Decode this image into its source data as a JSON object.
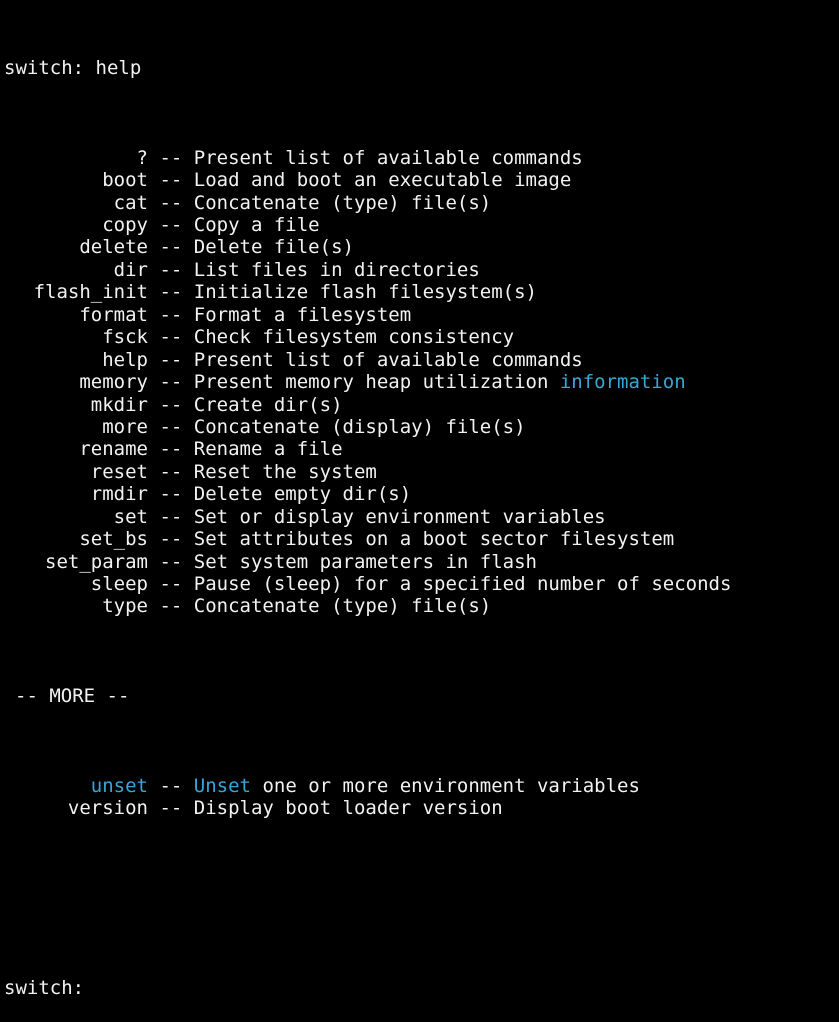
{
  "terminal": {
    "command_line": "switch: help",
    "separator": "--",
    "commands": [
      {
        "name": "?",
        "description": "Present list of available commands"
      },
      {
        "name": "boot",
        "description": "Load and boot an executable image"
      },
      {
        "name": "cat",
        "description": "Concatenate (type) file(s)"
      },
      {
        "name": "copy",
        "description": "Copy a file"
      },
      {
        "name": "delete",
        "description": "Delete file(s)"
      },
      {
        "name": "dir",
        "description": "List files in directories"
      },
      {
        "name": "flash_init",
        "description": "Initialize flash filesystem(s)"
      },
      {
        "name": "format",
        "description": "Format a filesystem"
      },
      {
        "name": "fsck",
        "description": "Check filesystem consistency"
      },
      {
        "name": "help",
        "description": "Present list of available commands"
      },
      {
        "name": "memory",
        "description": "Present memory heap utilization ",
        "highlight_word": "information"
      },
      {
        "name": "mkdir",
        "description": "Create dir(s)"
      },
      {
        "name": "more",
        "description": "Concatenate (display) file(s)"
      },
      {
        "name": "rename",
        "description": "Rename a file"
      },
      {
        "name": "reset",
        "description": "Reset the system"
      },
      {
        "name": "rmdir",
        "description": "Delete empty dir(s)"
      },
      {
        "name": "set",
        "description": "Set or display environment variables"
      },
      {
        "name": "set_bs",
        "description": "Set attributes on a boot sector filesystem"
      },
      {
        "name": "set_param",
        "description": "Set system parameters in flash"
      },
      {
        "name": "sleep",
        "description": "Pause (sleep) for a specified number of seconds"
      },
      {
        "name": "type",
        "description": "Concatenate (type) file(s)"
      }
    ],
    "more_prompt": "-- MORE --",
    "commands_after_more": [
      {
        "name": "unset",
        "highlight_word": "Unset",
        "description": " one or more environment variables"
      },
      {
        "name": "version",
        "description": "Display boot loader version"
      }
    ],
    "final_prompt": "switch:",
    "highlight_color": "#3aa6d8",
    "text_color": "#f2f2f2",
    "background_color": "#000000"
  }
}
